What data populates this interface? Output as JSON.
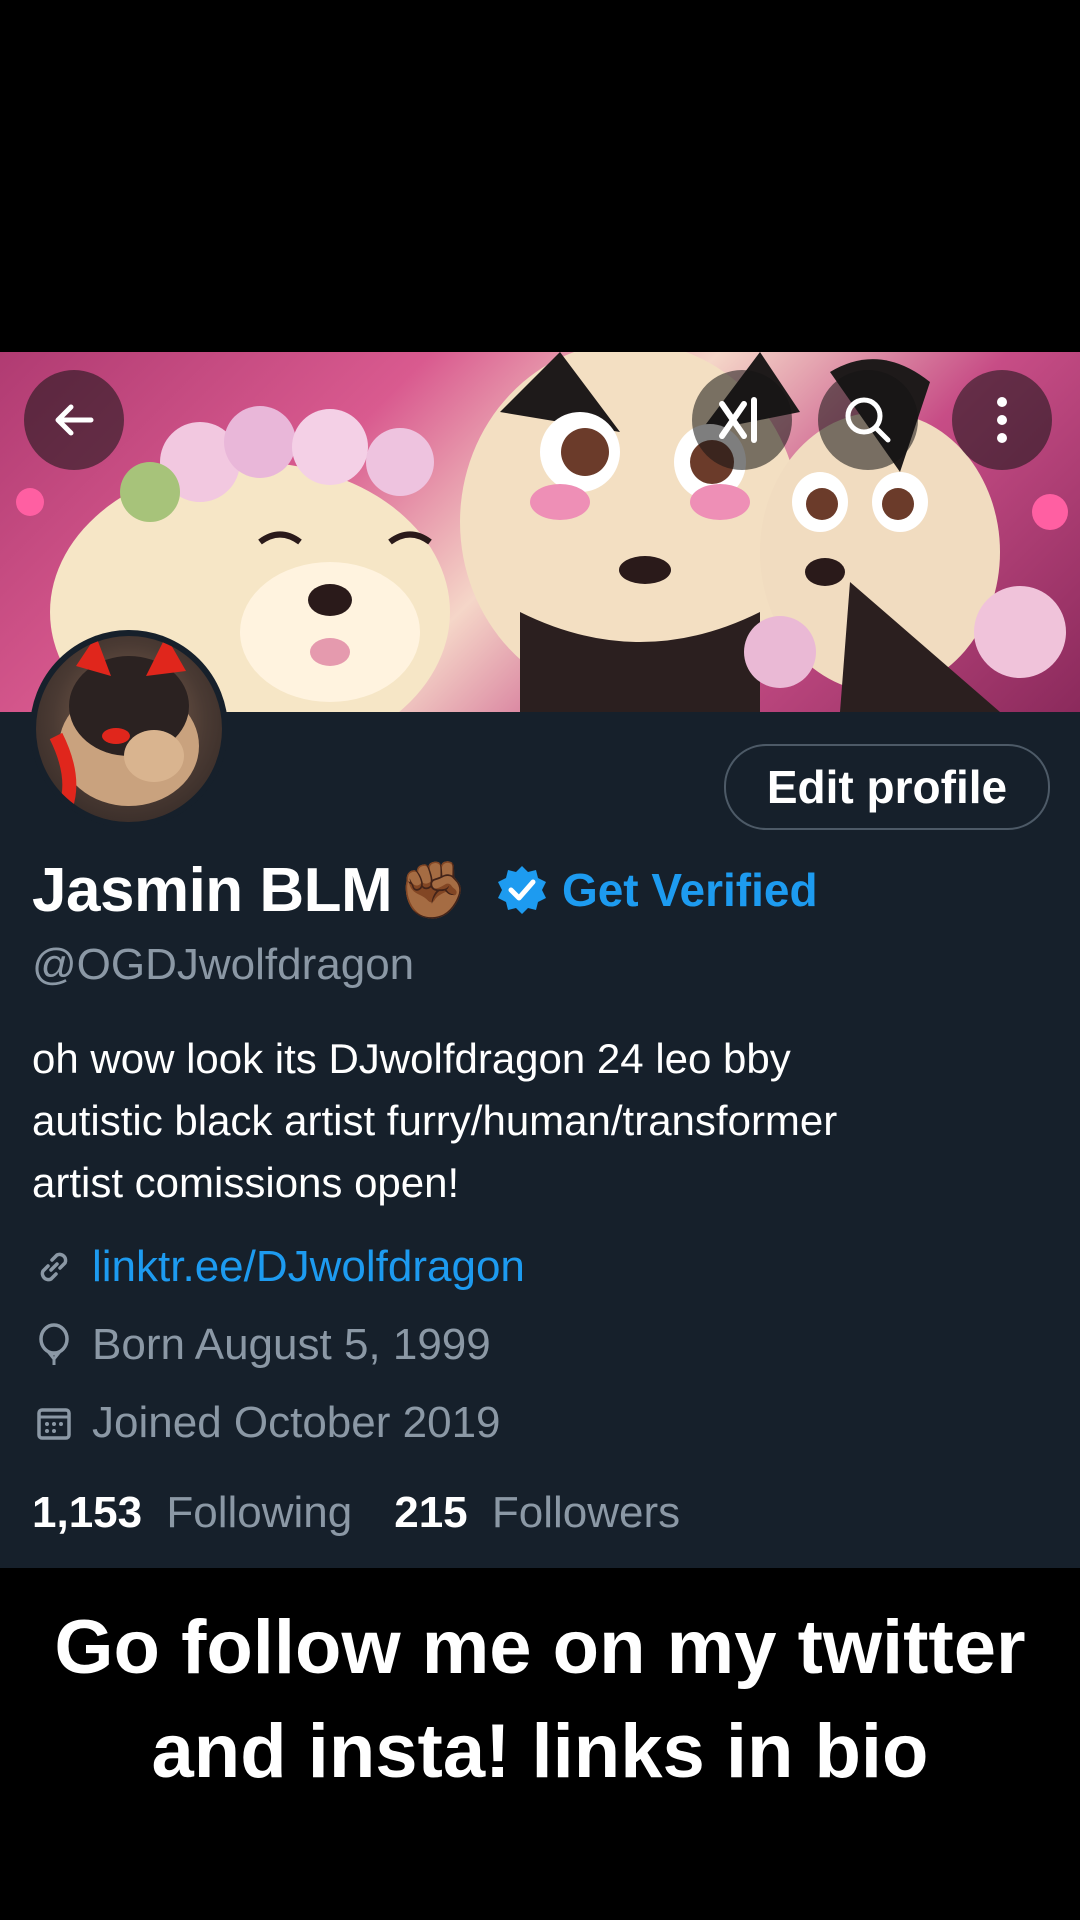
{
  "profile": {
    "display_name": "Jasmin BLM",
    "name_emoji": "✊🏾",
    "get_verified_label": "Get Verified",
    "handle": "@OGDJwolfdragon",
    "bio_lines": [
      "oh wow look its DJwolfdragon 24 leo bby",
      "autistic black artist furry/human/transformer",
      "artist comissions open!"
    ],
    "link": "linktr.ee/DJwolfdragon",
    "born": "Born August 5, 1999",
    "joined": "Joined October 2019",
    "following_count": "1,153",
    "following_label": "Following",
    "followers_count": "215",
    "followers_label": "Followers",
    "edit_profile_label": "Edit profile"
  },
  "icons": {
    "back": "arrow-left-icon",
    "grok": "grok-icon",
    "search": "search-icon",
    "more": "more-vertical-icon",
    "verified": "verified-badge-icon",
    "link": "link-icon",
    "birthday": "balloon-icon",
    "joined": "calendar-icon"
  },
  "colors": {
    "background": "#16202b",
    "accent": "#1d9bf0",
    "muted": "#8b98a5"
  },
  "caption": {
    "line1": "Go follow me on my twitter",
    "line2": "and insta! links in bio"
  }
}
